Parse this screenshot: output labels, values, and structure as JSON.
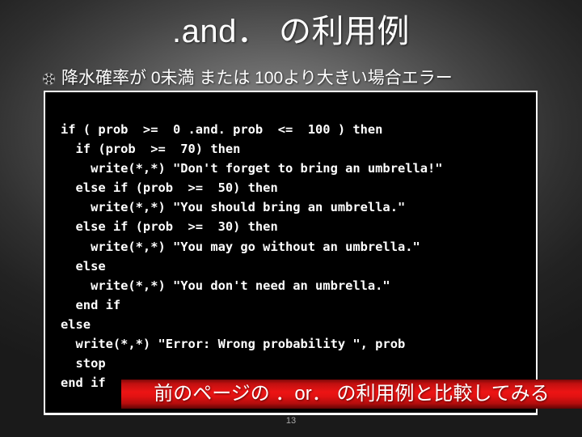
{
  "slide": {
    "title": ".and． の利用例",
    "bullet": {
      "icon": "flower-bullet-icon",
      "text": "降水確率が 0未満 または 100より大きい場合エラー"
    },
    "code": "if ( prob  >=  0 .and. prob  <=  100 ) then\n  if (prob  >=  70) then\n    write(*,*) \"Don't forget to bring an umbrella!\"\n  else if (prob  >=  50) then\n    write(*,*) \"You should bring an umbrella.\"\n  else if (prob  >=  30) then\n    write(*,*) \"You may go without an umbrella.\"\n  else\n    write(*,*) \"You don't need an umbrella.\"\n  end if\nelse\n  write(*,*) \"Error: Wrong probability \", prob\n  stop\nend if",
    "callout": "前のページの ．or． の利用例と比較してみる",
    "page_number": "13"
  },
  "colors": {
    "callout_red": "#ec1414",
    "code_background": "#000000",
    "code_text": "#ffffff",
    "title_text": "#ffffff",
    "page_number_text": "#a9a9a9"
  }
}
